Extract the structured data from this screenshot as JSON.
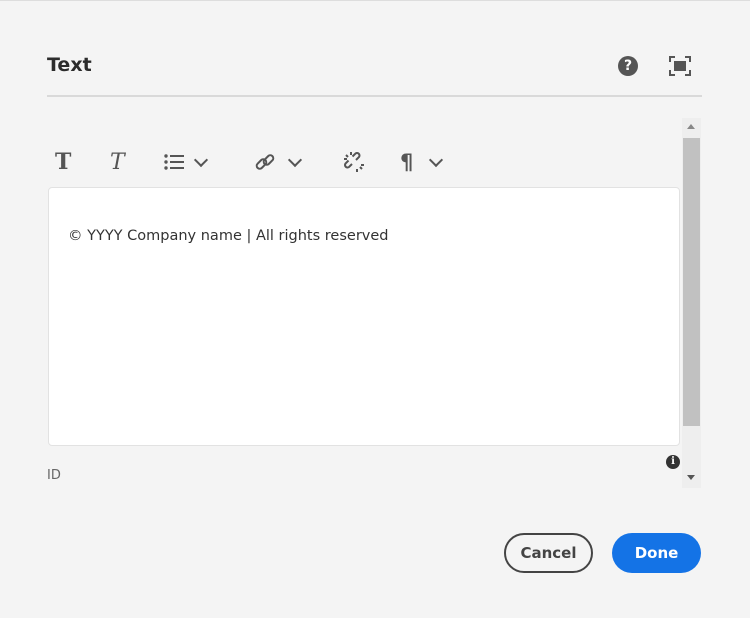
{
  "dialog": {
    "title": "Text",
    "help_icon": "help-icon",
    "fullscreen_icon": "fullscreen-icon"
  },
  "toolbar": {
    "items": [
      "bold-icon",
      "italic-icon",
      "list-icon",
      "link-icon",
      "unlink-icon",
      "paragraph-icon"
    ]
  },
  "editor": {
    "content": "© YYYY Company name | All rights reserved"
  },
  "field": {
    "id_label": "ID"
  },
  "footer": {
    "cancel": "Cancel",
    "done": "Done"
  },
  "colors": {
    "accent": "#1473e6"
  }
}
